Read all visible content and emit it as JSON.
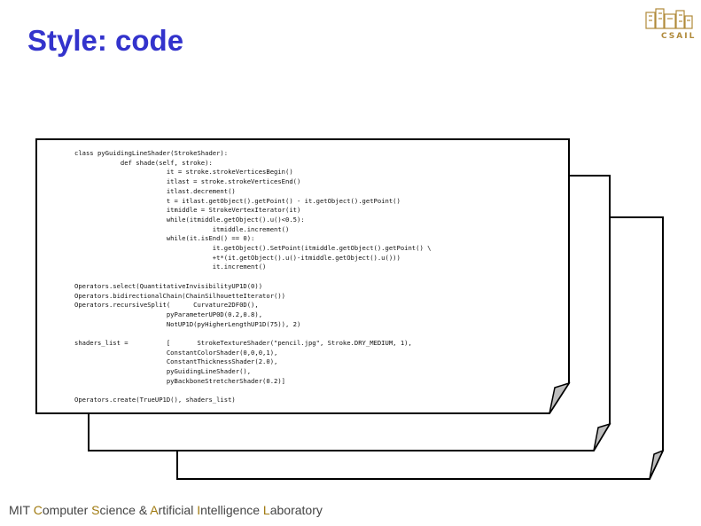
{
  "slide": {
    "title": "Style: code"
  },
  "logo": {
    "text": "CSAIL",
    "color": "#b08a3a"
  },
  "code": {
    "text": "class pyGuidingLineShader(StrokeShader):\n            def shade(self, stroke):\n                        it = stroke.strokeVerticesBegin()\n                        itlast = stroke.strokeVerticesEnd()\n                        itlast.decrement()\n                        t = itlast.getObject().getPoint() - it.getObject().getPoint()\n                        itmiddle = StrokeVertexIterator(it)\n                        while(itmiddle.getObject().u()<0.5):\n                                    itmiddle.increment()\n                        while(it.isEnd() == 0):\n                                    it.getObject().SetPoint(itmiddle.getObject().getPoint() \\\n                                    +t*(it.getObject().u()-itmiddle.getObject().u()))\n                                    it.increment()\n\nOperators.select(QuantitativeInvisibilityUP1D(0))\nOperators.bidirectionalChain(ChainSilhouetteIterator())\nOperators.recursiveSplit(      Curvature2DF0D(),\n                        pyParameterUP0D(0.2,0.8),\n                        NotUP1D(pyHigherLengthUP1D(75)), 2)\n\nshaders_list =          [       StrokeTextureShader(\"pencil.jpg\", Stroke.DRY_MEDIUM, 1),\n                        ConstantColorShader(0,0,0,1),\n                        ConstantThicknessShader(2.0),\n                        pyGuidingLineShader(),\n                        pyBackboneStretcherShader(0.2)]\n\nOperators.create(TrueUP1D(), shaders_list)"
  },
  "footer": {
    "parts": [
      {
        "text": "MIT ",
        "highlight": false
      },
      {
        "text": "C",
        "highlight": true
      },
      {
        "text": "omputer ",
        "highlight": false
      },
      {
        "text": "S",
        "highlight": true
      },
      {
        "text": "cience & ",
        "highlight": false
      },
      {
        "text": "A",
        "highlight": true
      },
      {
        "text": "rtificial ",
        "highlight": false
      },
      {
        "text": "I",
        "highlight": true
      },
      {
        "text": "ntelligence ",
        "highlight": false
      },
      {
        "text": "L",
        "highlight": true
      },
      {
        "text": "aboratory",
        "highlight": false
      }
    ]
  },
  "colors": {
    "title": "#3333cc",
    "footer_highlight": "#a07a10"
  }
}
